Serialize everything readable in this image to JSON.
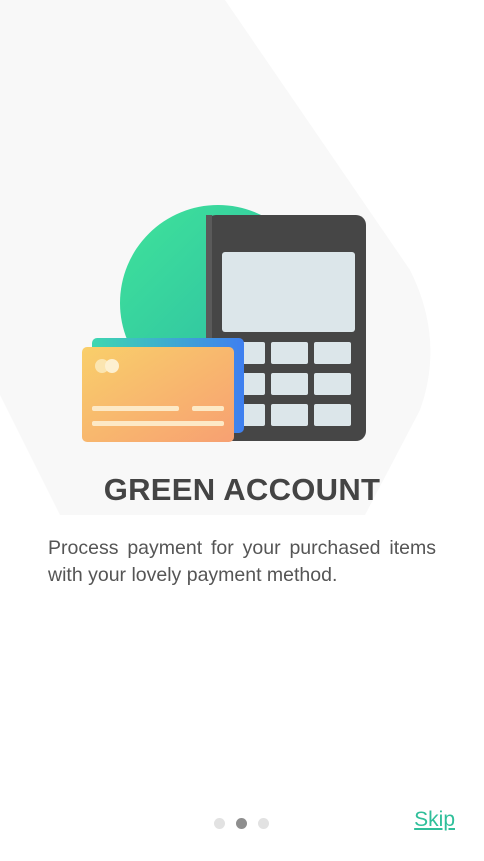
{
  "onboarding": {
    "title": "GREEN ACCOUNT",
    "description": "Process payment for your purchased items with your lovely payment method.",
    "skip_label": "Skip",
    "current_page": 2,
    "total_pages": 3
  },
  "colors": {
    "accent": "#2fbf9a",
    "title": "#444444",
    "text": "#555555",
    "dot_active": "#8e8e8e",
    "dot_inactive": "#e2e2e2"
  },
  "illustration": {
    "icons": [
      "green-circle",
      "payment-terminal-icon",
      "credit-card-icon"
    ]
  }
}
